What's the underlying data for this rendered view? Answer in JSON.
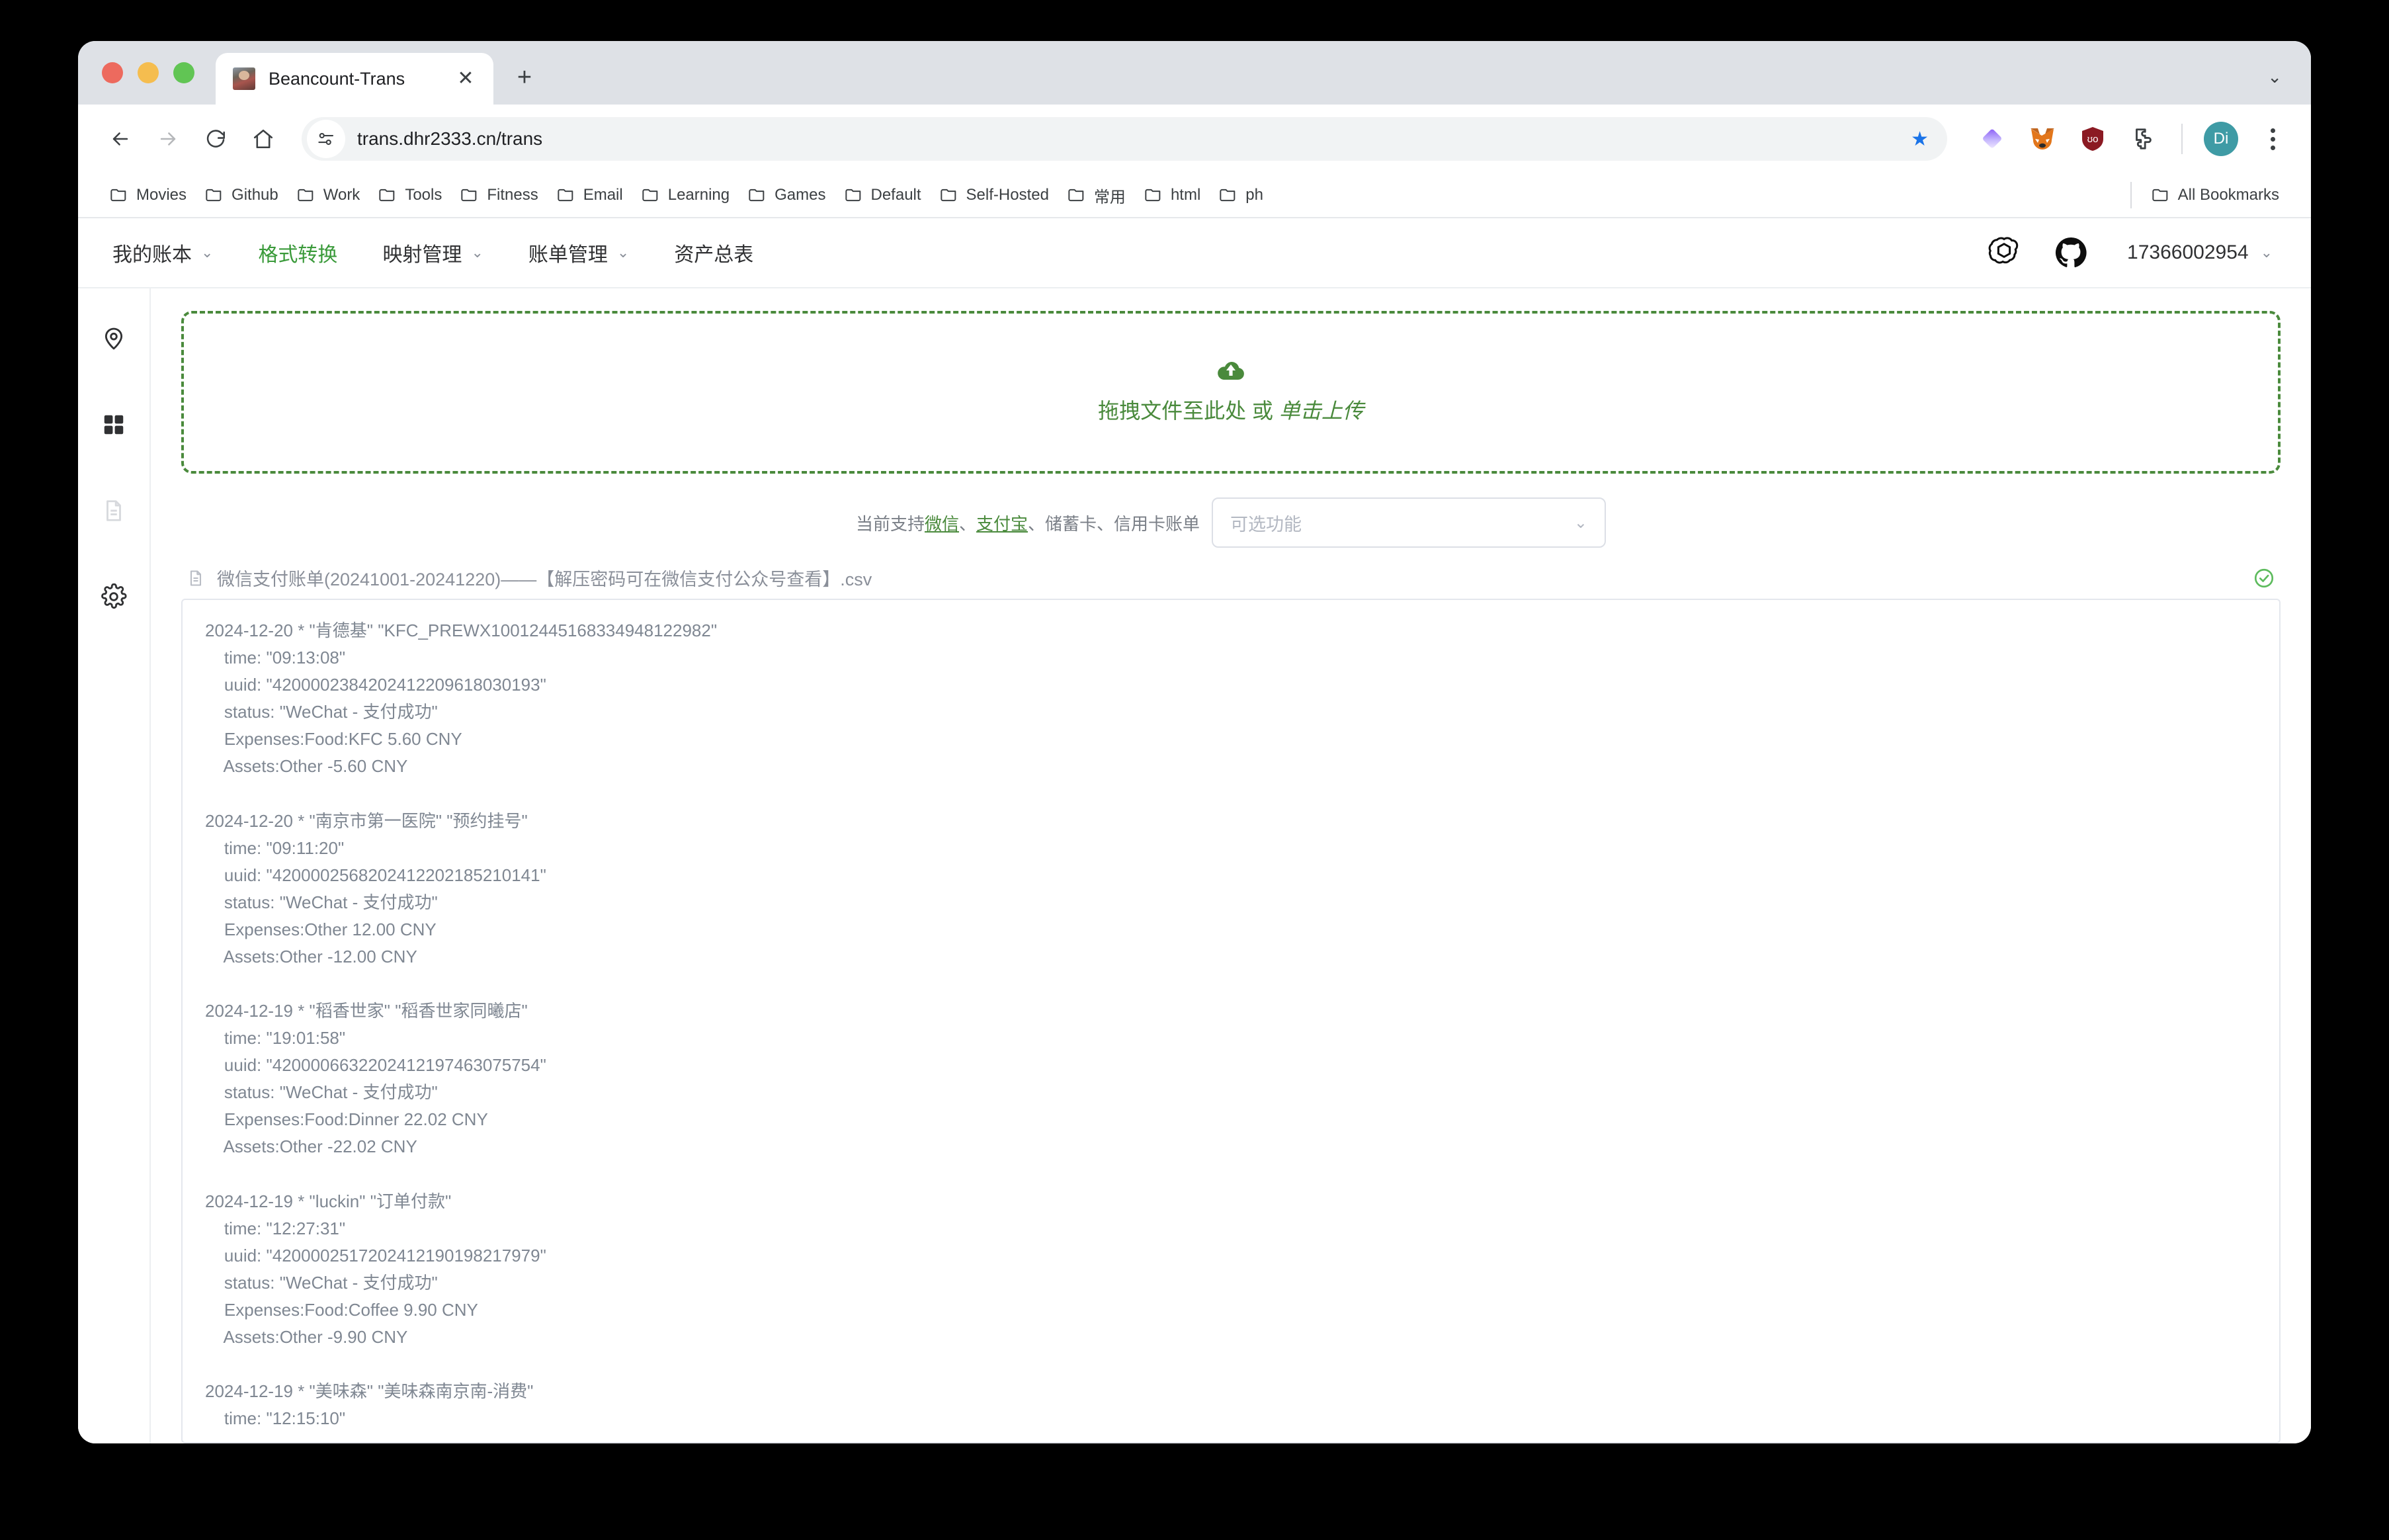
{
  "browser": {
    "tab": {
      "title": "Beancount-Trans",
      "favicon": "avatar-photo-favicon",
      "close_label": "✕"
    },
    "new_tab_label": "+",
    "tab_strip_chevron": "⌄",
    "omnibox": {
      "url": "trans.dhr2333.cn/trans",
      "site_icon": "page-settings-icon",
      "star": "★"
    },
    "nav": {
      "back": "←",
      "forward": "→",
      "reload": "⟳",
      "home": "⌂"
    },
    "extensions": [
      "gradient-diamond-extension-icon",
      "metamask-fox-icon",
      "ublock-origin-icon",
      "puzzle-extensions-icon"
    ],
    "profile_initials": "Di",
    "menu": "kebab-menu-icon",
    "bookmarks": [
      {
        "label": "Movies"
      },
      {
        "label": "Github"
      },
      {
        "label": "Work"
      },
      {
        "label": "Tools"
      },
      {
        "label": "Fitness"
      },
      {
        "label": "Email"
      },
      {
        "label": "Learning"
      },
      {
        "label": "Games"
      },
      {
        "label": "Default"
      },
      {
        "label": "Self-Hosted"
      },
      {
        "label": "常用"
      },
      {
        "label": "html"
      },
      {
        "label": "ph"
      }
    ],
    "all_bookmarks_label": "All Bookmarks"
  },
  "app": {
    "nav": [
      {
        "label": "我的账本",
        "caret": "⌄",
        "active": false
      },
      {
        "label": "格式转换",
        "caret": "",
        "active": true
      },
      {
        "label": "映射管理",
        "caret": "⌄",
        "active": false
      },
      {
        "label": "账单管理",
        "caret": "⌄",
        "active": false
      },
      {
        "label": "资产总表",
        "caret": "",
        "active": false
      }
    ],
    "nav_icons": [
      "openai-logo-icon",
      "github-logo-icon"
    ],
    "user": {
      "name": "17366002954",
      "caret": "⌄"
    },
    "accent_color": "#3a9a3a",
    "sidebar": [
      {
        "name": "location-pin-icon",
        "muted": false
      },
      {
        "name": "grid-apps-icon",
        "muted": false
      },
      {
        "name": "document-icon",
        "muted": true
      },
      {
        "name": "gear-icon",
        "muted": false
      }
    ],
    "dropzone": {
      "icon": "cloud-upload-icon",
      "text_main": "拖拽文件至此处 或 ",
      "text_em": "单击上传",
      "border_color": "#4a8a3c"
    },
    "support": {
      "prefix": "当前支持",
      "link1": "微信",
      "sep1": "、",
      "link2": "支付宝",
      "suffix": "、储蓄卡、信用卡账单",
      "select_placeholder": "可选功能",
      "select_caret": "⌄"
    },
    "file": {
      "icon": "file-document-icon",
      "name": "微信支付账单(20241001-20241220)——【解压密码可在微信支付公众号查看】.csv",
      "status_icon": "check-circle-icon",
      "status_color": "#5dbb5d"
    },
    "preview_text": "2024-12-20 * \"肯德基\" \"KFC_PREWX10012445168334948122982\"\n    time: \"09:13:08\"\n    uuid: \"4200002384202412209618030193\"\n    status: \"WeChat - 支付成功\"\n    Expenses:Food:KFC 5.60 CNY\n    Assets:Other -5.60 CNY\n\n2024-12-20 * \"南京市第一医院\" \"预约挂号\"\n    time: \"09:11:20\"\n    uuid: \"4200002568202412202185210141\"\n    status: \"WeChat - 支付成功\"\n    Expenses:Other 12.00 CNY\n    Assets:Other -12.00 CNY\n\n2024-12-19 * \"稻香世家\" \"稻香世家同曦店\"\n    time: \"19:01:58\"\n    uuid: \"4200006632202412197463075754\"\n    status: \"WeChat - 支付成功\"\n    Expenses:Food:Dinner 22.02 CNY\n    Assets:Other -22.02 CNY\n\n2024-12-19 * \"luckin\" \"订单付款\"\n    time: \"12:27:31\"\n    uuid: \"4200002517202412190198217979\"\n    status: \"WeChat - 支付成功\"\n    Expenses:Food:Coffee 9.90 CNY\n    Assets:Other -9.90 CNY\n\n2024-12-19 * \"美味森\" \"美味森南京南-消费\"\n    time: \"12:15:10\""
  }
}
